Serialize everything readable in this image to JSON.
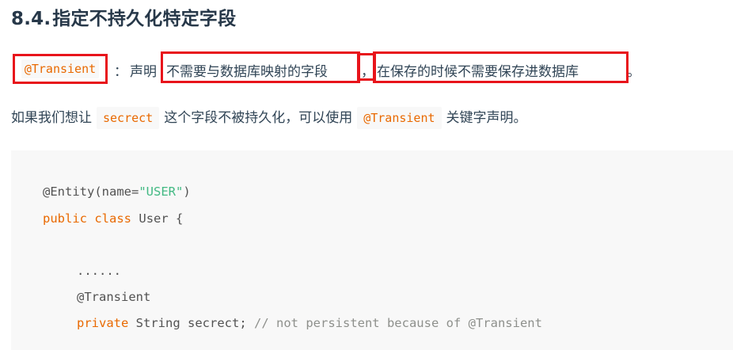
{
  "heading": {
    "number": "8.4.",
    "title": "指定不持久化特定字段"
  },
  "line1": {
    "annotation_code": "@Transient",
    "colon": "：",
    "prefix": "声明",
    "part_a": "不需要与数据库映射的字段",
    "separator": "，",
    "part_b": "在保存的时候不需要保存进数据库",
    "end": "。"
  },
  "line2": {
    "text_before": "如果我们想让",
    "code_field": "secrect",
    "text_middle": "这个字段不被持久化，可以使用",
    "code_annotation": "@Transient",
    "text_after": "关键字声明。"
  },
  "code": {
    "line1_annotation": "@Entity(name=",
    "line1_string": "\"USER\"",
    "line1_close": ")",
    "line2_kw1": "public",
    "line2_kw2": "class",
    "line2_rest": "User {",
    "line4_ellipsis": "......",
    "line5_annotation": "@Transient",
    "line6_kw": "private",
    "line6_rest": "String secrect;",
    "line6_comment": "// not persistent because of @Transient"
  },
  "colors": {
    "highlight_box": "#e8141b",
    "inline_code": "#e96900",
    "string": "#42b983",
    "comment": "#8e908c",
    "code_bg": "#f8f8f8"
  }
}
